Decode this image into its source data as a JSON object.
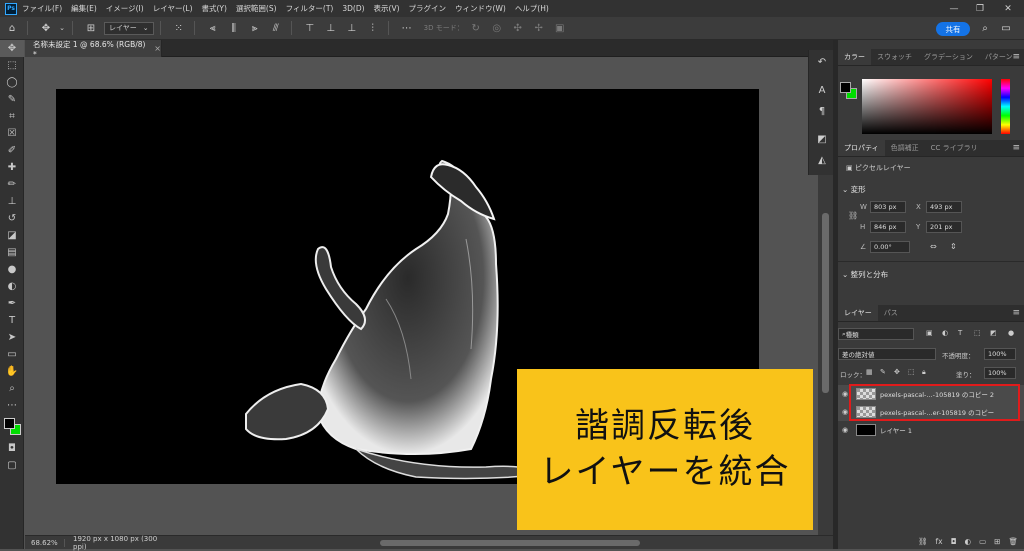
{
  "app": {
    "logo": "Ps"
  },
  "menu": [
    "ファイル(F)",
    "編集(E)",
    "イメージ(I)",
    "レイヤー(L)",
    "書式(Y)",
    "選択範囲(S)",
    "フィルター(T)",
    "3D(D)",
    "表示(V)",
    "プラグイン",
    "ウィンドウ(W)",
    "ヘルプ(H)"
  ],
  "window_controls": {
    "minimize": "—",
    "restore": "❐",
    "close": "✕"
  },
  "options_bar": {
    "auto_select_value": "レイヤー",
    "three_d_mode": "3D モード：",
    "share_label": "共有"
  },
  "document": {
    "tab_title": "名称未設定 1 @ 68.6% (RGB/8) *",
    "tab_close": "×"
  },
  "status": {
    "zoom": "68.62%",
    "doc_info": "1920 px x 1080 px (300 ppi)"
  },
  "callout": {
    "line1": "諧調反転後",
    "line2": "レイヤーを統合"
  },
  "color_panel": {
    "tabs": [
      "カラー",
      "スウォッチ",
      "グラデーション",
      "パターン"
    ],
    "foreground": "#000000",
    "background": "#00dd00"
  },
  "properties_panel": {
    "tabs": [
      "プロパティ",
      "色調補正",
      "CC ライブラリ"
    ],
    "layer_type": "ピクセルレイヤー",
    "transform_label": "変形",
    "w_label": "W",
    "w_value": "803 px",
    "x_label": "X",
    "x_value": "493 px",
    "h_label": "H",
    "h_value": "846 px",
    "y_label": "Y",
    "y_value": "201 px",
    "angle_value": "0.00°",
    "align_label": "整列と分布"
  },
  "layers_panel": {
    "tabs": [
      "レイヤー",
      "パス"
    ],
    "filter_label": "種類",
    "blend_mode": "差の絶対値",
    "opacity_label": "不透明度：",
    "opacity_value": "100%",
    "lock_label": "ロック：",
    "fill_label": "塗り：",
    "fill_value": "100%",
    "layers": [
      {
        "name": "pexels-pascal-...-105819 のコピー 2",
        "thumb": "checker"
      },
      {
        "name": "pexels-pascal-...er-105819 のコピー",
        "thumb": "checker"
      },
      {
        "name": "レイヤー 1",
        "thumb": "black"
      }
    ]
  },
  "highlight_color": "#e01b1b",
  "callout_color": "#f9c31a"
}
